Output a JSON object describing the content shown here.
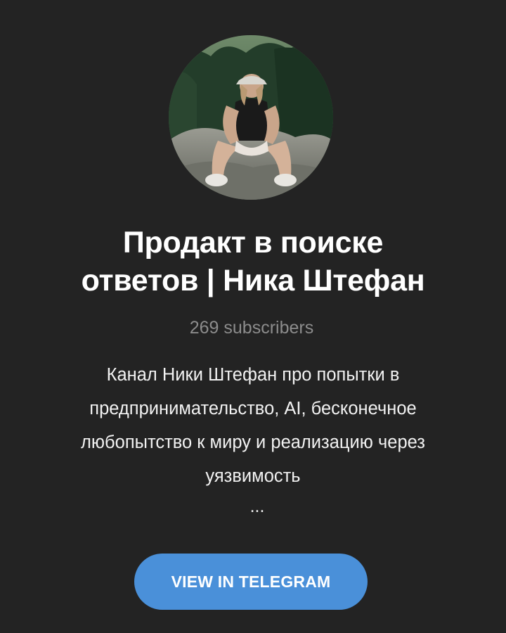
{
  "channel": {
    "title_line1": "Продакт в поиске",
    "title_line2": "ответов | Ника Штефан",
    "subscribers": "269 subscribers",
    "description_lines": [
      "Канал Ники Штефан про попытки в",
      "предпринимательство, AI, бесконечное",
      "любопытство к миру и реализацию через",
      "уязвимость"
    ],
    "more": "...",
    "avatar_icon": "avatar-photo"
  },
  "action": {
    "label": "VIEW IN TELEGRAM",
    "color": "#4a90d9"
  },
  "colors": {
    "background": "#232323",
    "subtitle": "#8c8c8c"
  }
}
